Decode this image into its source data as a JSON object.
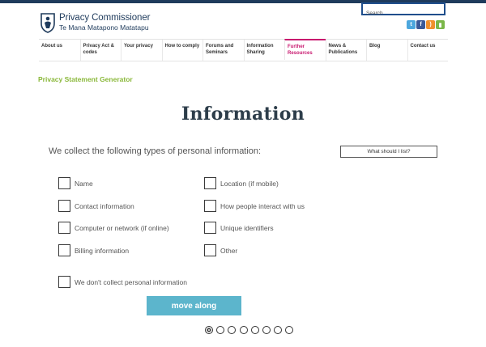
{
  "header": {
    "logo_title": "Privacy Commissioner",
    "logo_subtitle": "Te Mana Matapono Matatapu",
    "search_placeholder": "Search",
    "social": [
      {
        "name": "twitter-icon",
        "glyph": "t",
        "color": "#4da7de"
      },
      {
        "name": "facebook-icon",
        "glyph": "f",
        "color": "#3b5998"
      },
      {
        "name": "rss-icon",
        "glyph": ")",
        "color": "#f0902b"
      },
      {
        "name": "chat-icon",
        "glyph": "▮",
        "color": "#7ab648"
      }
    ]
  },
  "nav": {
    "items": [
      {
        "label": "About us",
        "active": false
      },
      {
        "label": "Privacy Act & codes",
        "active": false
      },
      {
        "label": "Your privacy",
        "active": false
      },
      {
        "label": "How to comply",
        "active": false
      },
      {
        "label": "Forums and Seminars",
        "active": false
      },
      {
        "label": "Information Sharing",
        "active": false
      },
      {
        "label": "Further Resources",
        "active": true
      },
      {
        "label": "News & Publications",
        "active": false
      },
      {
        "label": "Blog",
        "active": false
      },
      {
        "label": "Contact us",
        "active": false
      }
    ]
  },
  "page": {
    "section_label": "Privacy Statement Generator",
    "heading": "Information",
    "question": "We collect the following types of personal information:",
    "hint_button": "What should I list?",
    "options_left": [
      "Name",
      "Contact information",
      "Computer or network (if online)",
      "Billing information"
    ],
    "options_right": [
      "Location (if mobile)",
      "How people interact with us",
      "Unique identifiers",
      "Other"
    ],
    "option_none": "We don't collect personal information",
    "submit_label": "move along"
  },
  "pager": {
    "count": 8,
    "current": 1
  },
  "colors": {
    "brand_navy": "#1f3b5c",
    "accent_green": "#8ab83a",
    "active_nav": "#c8176e",
    "button": "#5cb5cc"
  }
}
